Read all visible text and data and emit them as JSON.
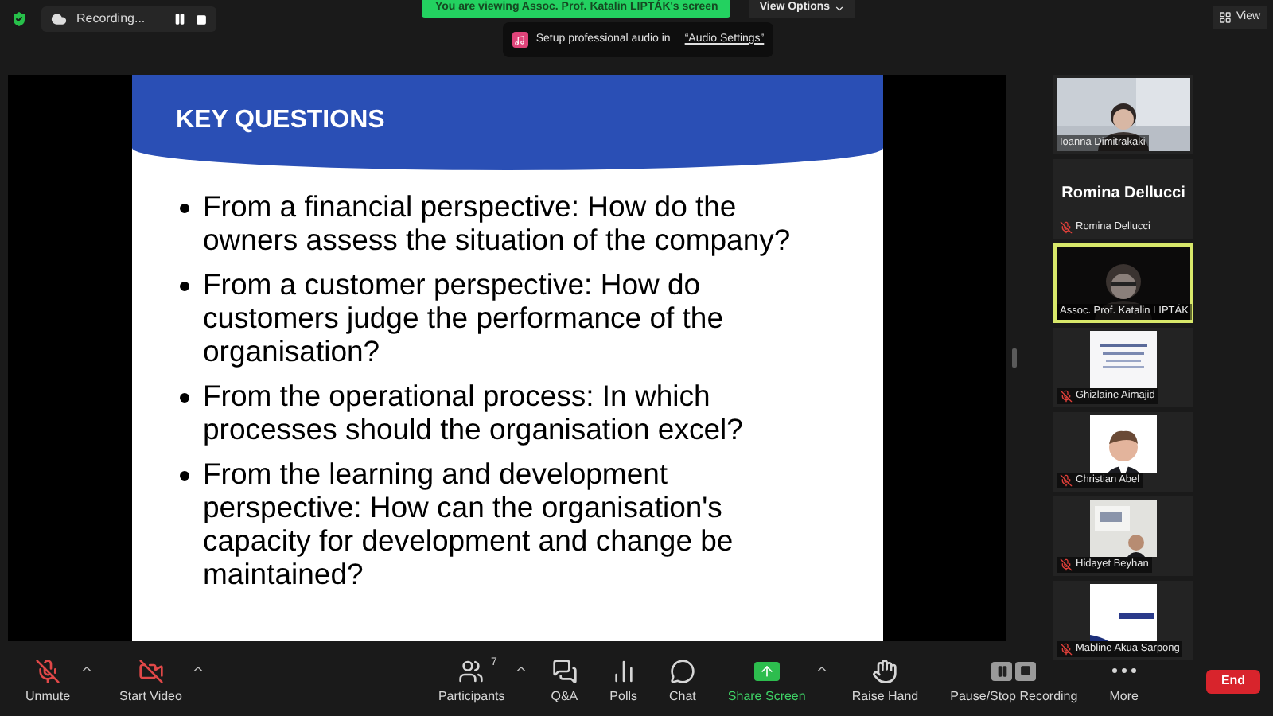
{
  "top_bar": {
    "recording": "Recording...",
    "share_banner": "You are viewing Assoc. Prof. Katalin LIPTÁK's screen",
    "view_options": "View Options",
    "notification": {
      "text": "Setup professional audio in",
      "link": "“Audio Settings”"
    },
    "view_button": "View"
  },
  "slide": {
    "title": "KEY QUESTIONS",
    "bullets": [
      "From a financial perspective: How do the owners assess the situation of the company?",
      "From a customer perspective: How do customers judge the performance of the organisation?",
      "From the operational process: In which processes should the organisation excel?",
      "From the learning and development perspective: How can the organisation's capacity for development and change be maintained?"
    ]
  },
  "participants": [
    {
      "name": "Ioanna Dimitrakaki",
      "kind": "wide_video",
      "muted": false,
      "speaking": false
    },
    {
      "name": "Romina Dellucci",
      "title": "Romina Dellucci",
      "kind": "name_only",
      "muted": true,
      "speaking": false
    },
    {
      "name": "Assoc. Prof. Katalin LIPTÁK",
      "kind": "wide_video",
      "muted": false,
      "speaking": true
    },
    {
      "name": "Ghizlaine Aimajid",
      "kind": "square_video",
      "muted": true,
      "speaking": false
    },
    {
      "name": "Christian Abel",
      "kind": "square_video",
      "muted": true,
      "speaking": false
    },
    {
      "name": "Hidayet Beyhan",
      "kind": "square_video",
      "muted": true,
      "speaking": false
    },
    {
      "name": "Mabline Akua Sarpong",
      "kind": "square_video",
      "muted": true,
      "speaking": false
    }
  ],
  "toolbar": {
    "items": [
      {
        "label": "Unmute",
        "kind": "mic",
        "menu": true,
        "highlighted": false
      },
      {
        "label": "Start Video",
        "kind": "video",
        "menu": true,
        "highlighted": false
      },
      {
        "label": "Participants",
        "kind": "participants",
        "count": "7",
        "menu": true,
        "highlighted": false
      },
      {
        "label": "Q&A",
        "kind": "qa",
        "menu": false,
        "highlighted": false
      },
      {
        "label": "Polls",
        "kind": "polls",
        "menu": false,
        "highlighted": false
      },
      {
        "label": "Chat",
        "kind": "chat",
        "menu": false,
        "highlighted": false
      },
      {
        "label": "Share Screen",
        "kind": "share",
        "menu": true,
        "highlighted": true
      },
      {
        "label": "Raise Hand",
        "kind": "hand",
        "menu": false,
        "highlighted": false
      },
      {
        "label": "Pause/Stop Recording",
        "kind": "recording",
        "menu": false,
        "highlighted": false
      },
      {
        "label": "More",
        "kind": "more",
        "menu": false,
        "highlighted": false
      }
    ],
    "end": "End"
  }
}
